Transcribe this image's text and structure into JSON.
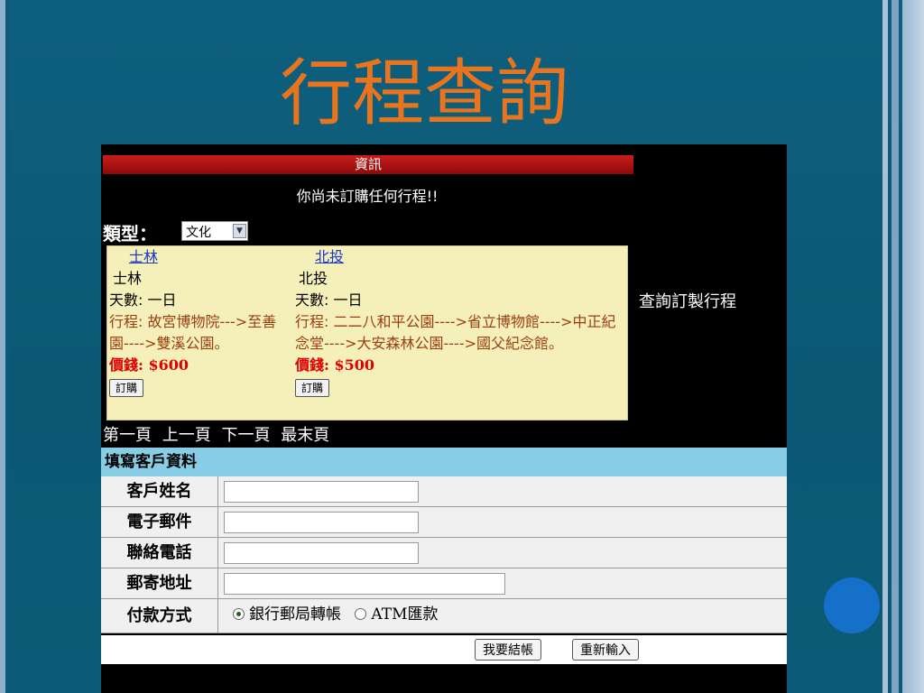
{
  "title": "行程查詢",
  "panel": {
    "info_header": "資訊",
    "notice": "你尚未訂購任何行程!!",
    "type_label": "類型：",
    "type_selected": "文化",
    "side_link": "查詢訂製行程",
    "trips": [
      {
        "link": "士林",
        "name": "士林",
        "days": "天數: 一日",
        "route": "行程: 故宮博物院--->至善園---->雙溪公園。",
        "price": "價錢: $600",
        "order": "訂購"
      },
      {
        "link": "北投",
        "name": "北投",
        "days": "天數: 一日",
        "route": "行程: 二二八和平公園---->省立博物館---->中正紀念堂---->大安森林公園---->國父紀念館。",
        "price": "價錢: $500",
        "order": "訂購"
      }
    ],
    "pager": {
      "first": "第一頁",
      "prev": "上一頁",
      "next": "下一頁",
      "last": "最末頁"
    }
  },
  "form": {
    "header": "填寫客戶資料",
    "name_label": "客戶姓名",
    "email_label": "電子郵件",
    "phone_label": "聯絡電話",
    "address_label": "郵寄地址",
    "payment_label": "付款方式",
    "payment_options": [
      "銀行郵局轉帳",
      "ATM匯款"
    ],
    "payment_selected": "銀行郵局轉帳",
    "checkout": "我要結帳",
    "reset": "重新輸入"
  },
  "colors": {
    "background": "#0b5a77",
    "title": "#e8741e",
    "header_bar": "#b01313",
    "card_bg": "#f5efba",
    "form_header": "#86cde5",
    "price": "#e00000",
    "dot": "#1470c8"
  }
}
